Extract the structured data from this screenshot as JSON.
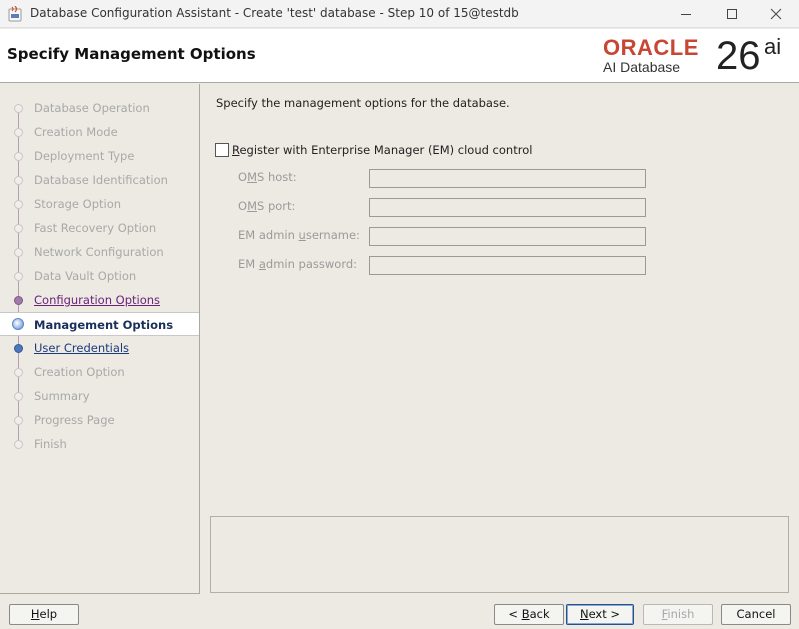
{
  "window": {
    "title": "Database Configuration Assistant - Create 'test' database - Step 10 of 15@testdb",
    "app_icon": "java-app-icon",
    "controls": [
      "minimize-icon",
      "maximize-icon",
      "close-icon"
    ]
  },
  "header": {
    "page_title": "Specify Management Options",
    "logo": {
      "brand": "ORACLE",
      "product": "AI Database",
      "version": "26",
      "version_suffix": "ai"
    }
  },
  "steps": [
    {
      "label": "Database Operation",
      "state": "disabled"
    },
    {
      "label": "Creation Mode",
      "state": "disabled"
    },
    {
      "label": "Deployment Type",
      "state": "disabled"
    },
    {
      "label": "Database Identification",
      "state": "disabled"
    },
    {
      "label": "Storage Option",
      "state": "disabled"
    },
    {
      "label": "Fast Recovery Option",
      "state": "disabled"
    },
    {
      "label": "Network Configuration",
      "state": "disabled"
    },
    {
      "label": "Data Vault Option",
      "state": "disabled"
    },
    {
      "label": "Configuration Options",
      "state": "visited"
    },
    {
      "label": "Management Options",
      "state": "current"
    },
    {
      "label": "User Credentials",
      "state": "next"
    },
    {
      "label": "Creation Option",
      "state": "disabled"
    },
    {
      "label": "Summary",
      "state": "disabled"
    },
    {
      "label": "Progress Page",
      "state": "disabled"
    },
    {
      "label": "Finish",
      "state": "disabled"
    }
  ],
  "main": {
    "intro": "Specify the management options for the database.",
    "em_checkbox": {
      "label_prefix": "",
      "mnemonic": "R",
      "label_rest": "egister with Enterprise Manager (EM) cloud control",
      "checked": false
    },
    "fields": [
      {
        "pre": "O",
        "mn": "M",
        "post": "S host:",
        "value": ""
      },
      {
        "pre": "O",
        "mn": "M",
        "post": "S port:",
        "value": ""
      },
      {
        "pre": "EM admin ",
        "mn": "u",
        "post": "sername:",
        "value": ""
      },
      {
        "pre": "EM ",
        "mn": "a",
        "post": "dmin password:",
        "value": ""
      }
    ]
  },
  "buttons": {
    "help": {
      "pre": "",
      "mn": "H",
      "post": "elp"
    },
    "back": {
      "pre": "< ",
      "mn": "B",
      "post": "ack"
    },
    "next": {
      "pre": "",
      "mn": "N",
      "post": "ext >"
    },
    "finish": {
      "pre": "",
      "mn": "F",
      "post": "inish"
    },
    "cancel": "Cancel"
  },
  "colors": {
    "oracle_red": "#c74634",
    "visited_step": "#6a1f7a",
    "next_step": "#1c3a7a",
    "panel_bg": "#eceae2"
  }
}
